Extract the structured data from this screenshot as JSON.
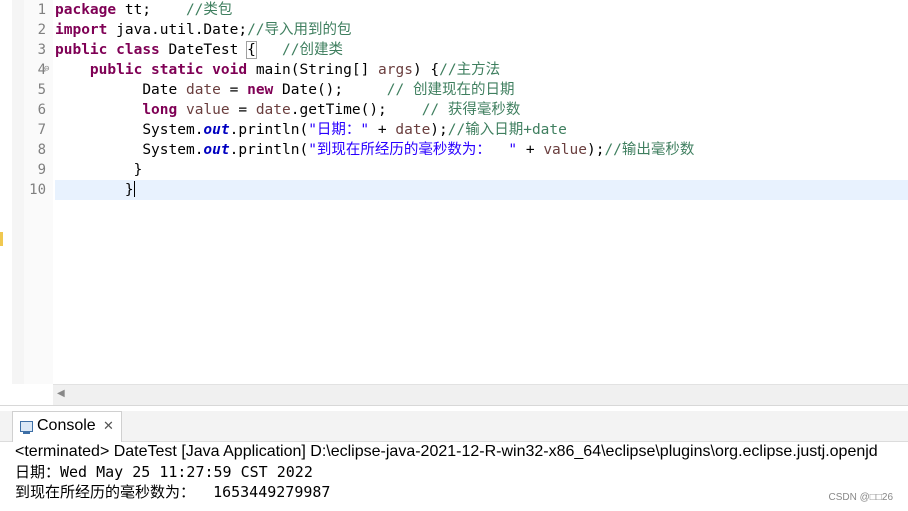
{
  "editor": {
    "line_numbers": [
      "1",
      "2",
      "3",
      "4",
      "5",
      "6",
      "7",
      "8",
      "9",
      "10"
    ],
    "code": {
      "l1_kw": "package",
      "l1_text": " tt;    ",
      "l1_cm": "//类包",
      "l2_kw": "import",
      "l2_text": " java.util.Date;",
      "l2_cm": "//导入用到的包",
      "l3_kw1": "public",
      "l3_kw2": "class",
      "l3_name": " DateTest ",
      "l3_brace": "{",
      "l3_gap": "   ",
      "l3_cm": "//创建类",
      "l4_indent": "    ",
      "l4_kw1": "public",
      "l4_kw2": "static",
      "l4_kw3": "void",
      "l4_text": " main(String[] ",
      "l4_var": "args",
      "l4_text2": ") {",
      "l4_cm": "//主方法",
      "l5_indent": "          ",
      "l5_text": "Date ",
      "l5_var": "date",
      "l5_text2": " = ",
      "l5_kw": "new",
      "l5_text3": " Date();     ",
      "l5_cm": "// 创建现在的日期",
      "l6_indent": "          ",
      "l6_kw": "long",
      "l6_sp": " ",
      "l6_var": "value",
      "l6_text": " = ",
      "l6_var2": "date",
      "l6_text2": ".getTime();    ",
      "l6_cm": "// 获得毫秒数",
      "l7_indent": "          ",
      "l7_text": "System.",
      "l7_field": "out",
      "l7_text2": ".println(",
      "l7_str": "\"日期：\"",
      "l7_text3": " + ",
      "l7_var": "date",
      "l7_text4": ");",
      "l7_cm": "//输入日期+date",
      "l8_indent": "          ",
      "l8_text": "System.",
      "l8_field": "out",
      "l8_text2": ".println(",
      "l8_str": "\"到现在所经历的毫秒数为：  \"",
      "l8_text3": " + ",
      "l8_var": "value",
      "l8_text4": ");",
      "l8_cm": "//输出毫秒数",
      "l9_text": "         }",
      "l10_text": "        }"
    },
    "fold_icon": "collapse-minus-icon",
    "scroll_arrow": "◀"
  },
  "console": {
    "tab_label": "Console",
    "close_glyph": "✕",
    "terminated_line": "<terminated> DateTest [Java Application] D:\\eclipse-java-2021-12-R-win32-x86_64\\eclipse\\plugins\\org.eclipse.justj.openjd",
    "output_line1": "日期：Wed May 25 11:27:59 CST 2022",
    "output_line2": "到现在所经历的毫秒数为：  1653449279987"
  },
  "watermark": "CSDN @□□26",
  "colors": {
    "keyword": "#7f0055",
    "comment": "#3f7f5f",
    "string": "#2a00ff",
    "field": "#0000c0",
    "current_line": "#e8f2fe"
  }
}
